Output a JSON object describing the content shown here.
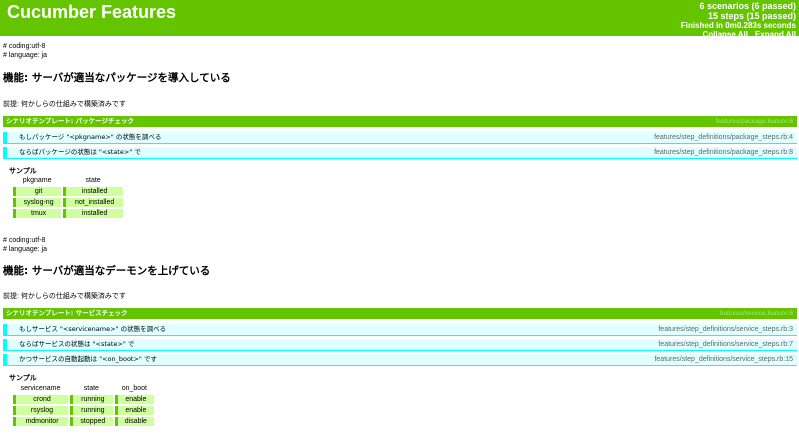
{
  "header": {
    "title": "Cucumber Features",
    "scenarios_summary": "6 scenarios (6 passed)",
    "steps_summary": "15 steps (15 passed)",
    "duration_prefix": "Finished in ",
    "duration_value": "0m0.283s",
    "duration_suffix": " seconds",
    "collapse_all": "Collapse All",
    "expand_all": "Expand All"
  },
  "features": [
    {
      "coding": "# coding:utf-8",
      "language": "# language: ja",
      "title": "機能: サーバが適当なパッケージを導入している",
      "background": "前提: 何かしらの仕組みで構築済みです",
      "scenario": "シナリオテンプレート: パッケージチェック",
      "scenario_tag": "features/package.feature:6",
      "steps": [
        {
          "text": "もしパッケージ \"<pkgname>\" の状態を調べる",
          "source": "features/step_definitions/package_steps.rb:4"
        },
        {
          "text": "ならばパッケージの状態は \"<state>\" で",
          "source": "features/step_definitions/package_steps.rb:8"
        }
      ],
      "examples_label": "サンプル",
      "examples_headers": [
        "pkgname",
        "state"
      ],
      "examples_rows": [
        [
          "git",
          "installed"
        ],
        [
          "syslog-ng",
          "not_installed"
        ],
        [
          "tmux",
          "installed"
        ]
      ]
    },
    {
      "coding": "# coding:utf-8",
      "language": "# language: ja",
      "title": "機能: サーバが適当なデーモンを上げている",
      "background": "前提: 何かしらの仕組みで構築済みです",
      "scenario": "シナリオテンプレート: サービスチェック",
      "scenario_tag": "features/service.feature:6",
      "steps": [
        {
          "text": "もしサービス \"<servicename>\" の状態を調べる",
          "source": "features/step_definitions/service_steps.rb:3"
        },
        {
          "text": "ならばサービスの状態は \"<state>\" で",
          "source": "features/step_definitions/service_steps.rb:7"
        },
        {
          "text": "かつサービスの自動起動は \"<on_boot>\" です",
          "source": "features/step_definitions/service_steps.rb:15"
        }
      ],
      "examples_label": "サンプル",
      "examples_headers": [
        "servicename",
        "state",
        "on_boot"
      ],
      "examples_rows": [
        [
          "crond",
          "running",
          "enable"
        ],
        [
          "rsyslog",
          "running",
          "enable"
        ],
        [
          "mdmonitor",
          "stopped",
          "disable"
        ]
      ]
    }
  ],
  "colors": {
    "passed": "#65c400",
    "step_bg": "#e0ffff",
    "step_bar": "#00ffff",
    "cell_bg": "#cfff9f"
  }
}
